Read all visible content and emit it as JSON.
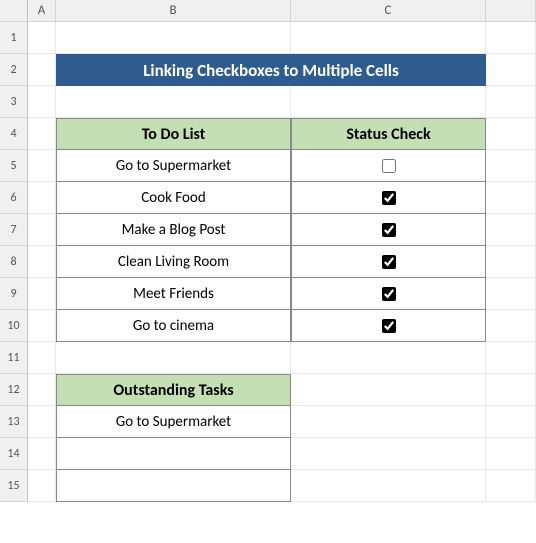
{
  "columns": [
    "",
    "A",
    "B",
    "C",
    ""
  ],
  "rows": [
    "1",
    "2",
    "3",
    "4",
    "5",
    "6",
    "7",
    "8",
    "9",
    "10",
    "11",
    "12",
    "13",
    "14",
    "15"
  ],
  "title": "Linking Checkboxes to Multiple Cells",
  "table1": {
    "headers": {
      "col1": "To Do List",
      "col2": "Status Check"
    },
    "items": [
      {
        "label": "Go to Supermarket",
        "checked": false
      },
      {
        "label": "Cook Food",
        "checked": true
      },
      {
        "label": "Make a Blog Post",
        "checked": true
      },
      {
        "label": "Clean Living Room",
        "checked": true
      },
      {
        "label": "Meet Friends",
        "checked": true
      },
      {
        "label": "Go to cinema",
        "checked": true
      }
    ]
  },
  "table2": {
    "header": "Outstanding Tasks",
    "items": [
      "Go to Supermarket",
      "",
      ""
    ]
  }
}
